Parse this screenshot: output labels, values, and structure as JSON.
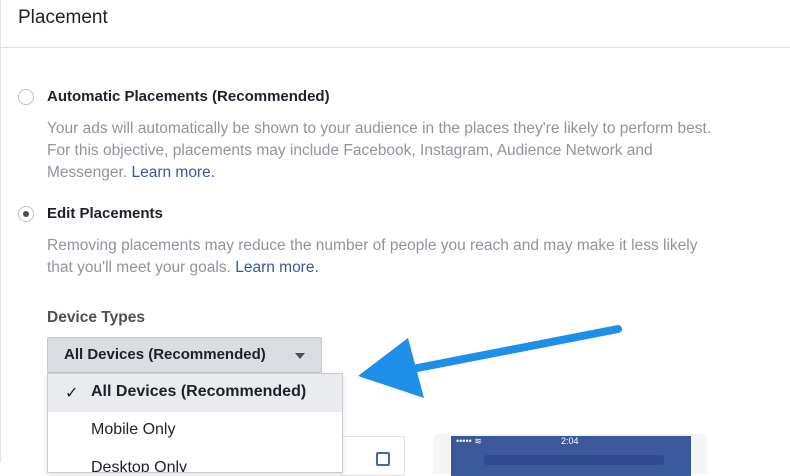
{
  "header": {
    "title": "Placement"
  },
  "options": {
    "automatic": {
      "label": "Automatic Placements (Recommended)",
      "desc_line1": "Your ads will automatically be shown to your audience in the places they're likely to perform best.",
      "desc_line2": "For this objective, placements may include Facebook, Instagram, Audience Network and",
      "desc_line3": "Messenger.",
      "link": "Learn more.",
      "selected": false
    },
    "edit": {
      "label": "Edit Placements",
      "desc_line1": "Removing placements may reduce the number of people you reach and may make it less likely",
      "desc_line2": "that you'll meet your goals.",
      "link": "Learn more.",
      "selected": true
    }
  },
  "device_types": {
    "label": "Device Types",
    "selected": "All Devices (Recommended)",
    "menu": [
      {
        "label": "All Devices (Recommended)",
        "checked": true
      },
      {
        "label": "Mobile Only",
        "checked": false
      },
      {
        "label": "Desktop Only",
        "checked": false
      }
    ]
  },
  "preview": {
    "phone_time": "2:04",
    "status_left": "••••• ≋"
  },
  "colors": {
    "link": "#365899",
    "arrow": "#1e8fe8",
    "menu_selected_bg": "#e9ebee"
  }
}
